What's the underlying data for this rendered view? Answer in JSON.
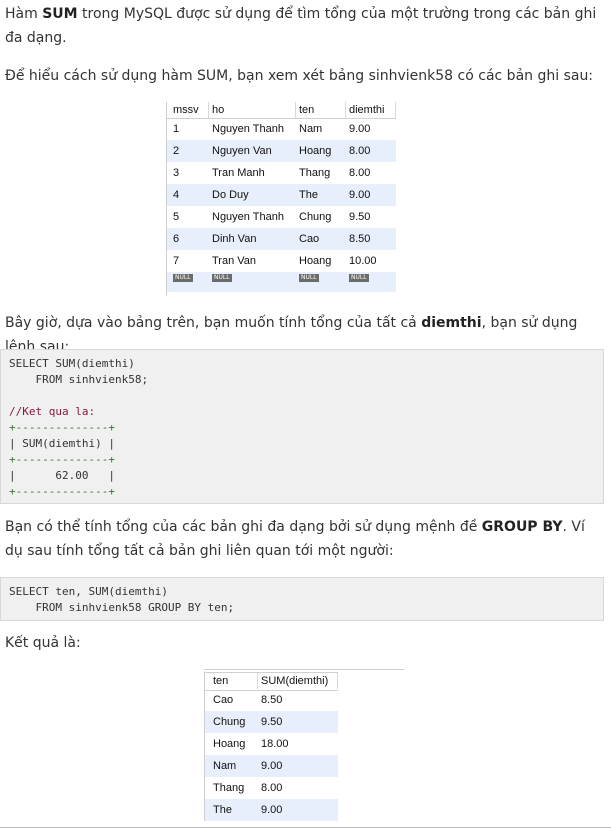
{
  "intro": {
    "p1_a": "Hàm ",
    "p1_b": "SUM",
    "p1_c": " trong MySQL được sử dụng để tìm tổng của một trường trong các bản ghi đa dạng.",
    "p2": "Để hiểu cách sử dụng hàm SUM, bạn xem xét bảng sinhvienk58 có các bản ghi sau:"
  },
  "table1": {
    "headers": [
      "mssv",
      "ho",
      "ten",
      "diemthi"
    ],
    "rows": [
      [
        "1",
        "Nguyen Thanh",
        "Nam",
        "9.00"
      ],
      [
        "2",
        "Nguyen Van",
        "Hoang",
        "8.00"
      ],
      [
        "3",
        "Tran Manh",
        "Thang",
        "8.00"
      ],
      [
        "4",
        "Do Duy",
        "The",
        "9.00"
      ],
      [
        "5",
        "Nguyen Thanh",
        "Chung",
        "9.50"
      ],
      [
        "6",
        "Dinh Van",
        "Cao",
        "8.50"
      ],
      [
        "7",
        "Tran Van",
        "Hoang",
        "10.00"
      ]
    ],
    "null_label": "NULL"
  },
  "para3": {
    "a": "Bây giờ, dựa vào bảng trên, bạn muốn tính tổng của tất cả ",
    "b": "diemthi",
    "c": ", bạn sử dụng lệnh sau:"
  },
  "code1": {
    "line1": "SELECT SUM(diemthi)",
    "line2": "    FROM sinhvienk58;",
    "comment": "//Ket qua la:",
    "border": "+--------------+",
    "header": "| SUM(diemthi) |",
    "value": "|      62.00   |"
  },
  "para4": {
    "a": "Bạn có thể tính tổng của các bản ghi đa dạng bởi sử dụng mệnh đề ",
    "b": "GROUP BY",
    "c": ". Ví dụ sau tính tổng tất cả bản ghi liên quan tới một người:"
  },
  "code2": {
    "line1": "SELECT ten, SUM(diemthi)",
    "line2": "    FROM sinhvienk58 GROUP BY ten;"
  },
  "para5": "Kết quả là:",
  "table2": {
    "headers": [
      "ten",
      "SUM(diemthi)"
    ],
    "rows": [
      [
        "Cao",
        "8.50"
      ],
      [
        "Chung",
        "9.50"
      ],
      [
        "Hoang",
        "18.00"
      ],
      [
        "Nam",
        "9.00"
      ],
      [
        "Thang",
        "8.00"
      ],
      [
        "The",
        "9.00"
      ]
    ]
  }
}
